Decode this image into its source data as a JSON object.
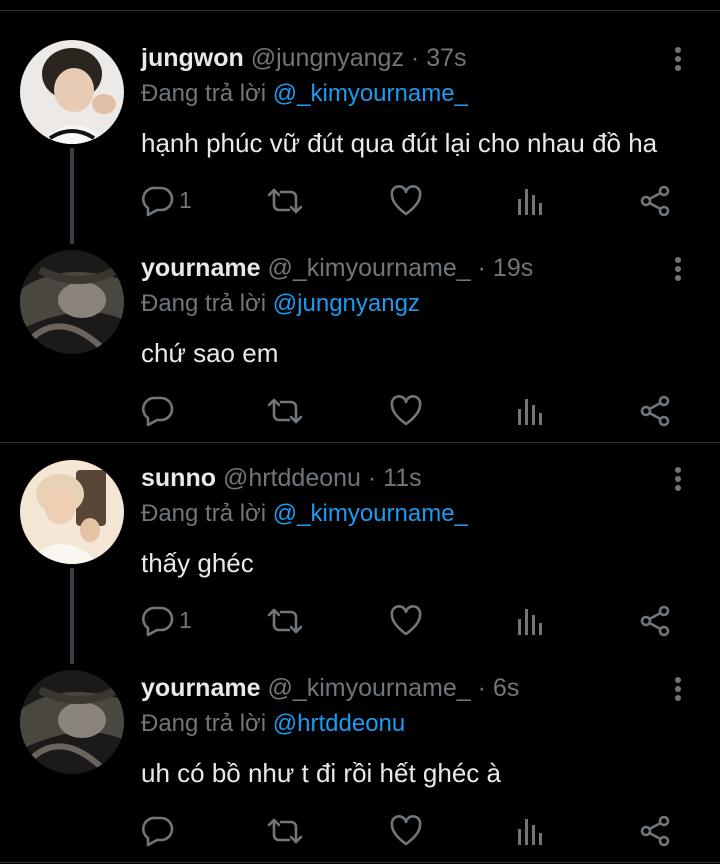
{
  "tweets": [
    {
      "name": "jungwon",
      "handle": "@jungnyangz",
      "time": "37s",
      "replying_prefix": "Đang trả lời",
      "replying_to": "@_kimyourname_",
      "text": "hạnh phúc vữ đút qua đút lại cho nhau đồ ha",
      "reply_count": "1",
      "avatar_colors": [
        "#d9d3cc",
        "#2b2520"
      ]
    },
    {
      "name": "yourname",
      "handle": "@_kimyourname_",
      "time": "19s",
      "replying_prefix": "Đang trả lời",
      "replying_to": "@jungnyangz",
      "text": "chứ sao em",
      "reply_count": "",
      "avatar_colors": [
        "#5a5650",
        "#1a1816"
      ]
    },
    {
      "name": "sunno",
      "handle": "@hrtddeonu",
      "time": "11s",
      "replying_prefix": "Đang trả lời",
      "replying_to": "@_kimyourname_",
      "text": "thấy ghéc",
      "reply_count": "1",
      "avatar_colors": [
        "#f0dcc3",
        "#8c7058"
      ]
    },
    {
      "name": "yourname",
      "handle": "@_kimyourname_",
      "time": "6s",
      "replying_prefix": "Đang trả lời",
      "replying_to": "@hrtddeonu",
      "text": "uh có bồ như t đi rồi hết ghéc à",
      "reply_count": "",
      "avatar_colors": [
        "#5a5650",
        "#1a1816"
      ]
    }
  ],
  "separator": "·",
  "icons": [
    "reply-icon",
    "retweet-icon",
    "like-icon",
    "analytics-icon",
    "share-icon",
    "more-icon"
  ],
  "colors": {
    "background": "#000000",
    "name": "#e7e9ea",
    "muted": "#71767b",
    "mention": "#1d9bf0",
    "divider": "#2f3336"
  }
}
